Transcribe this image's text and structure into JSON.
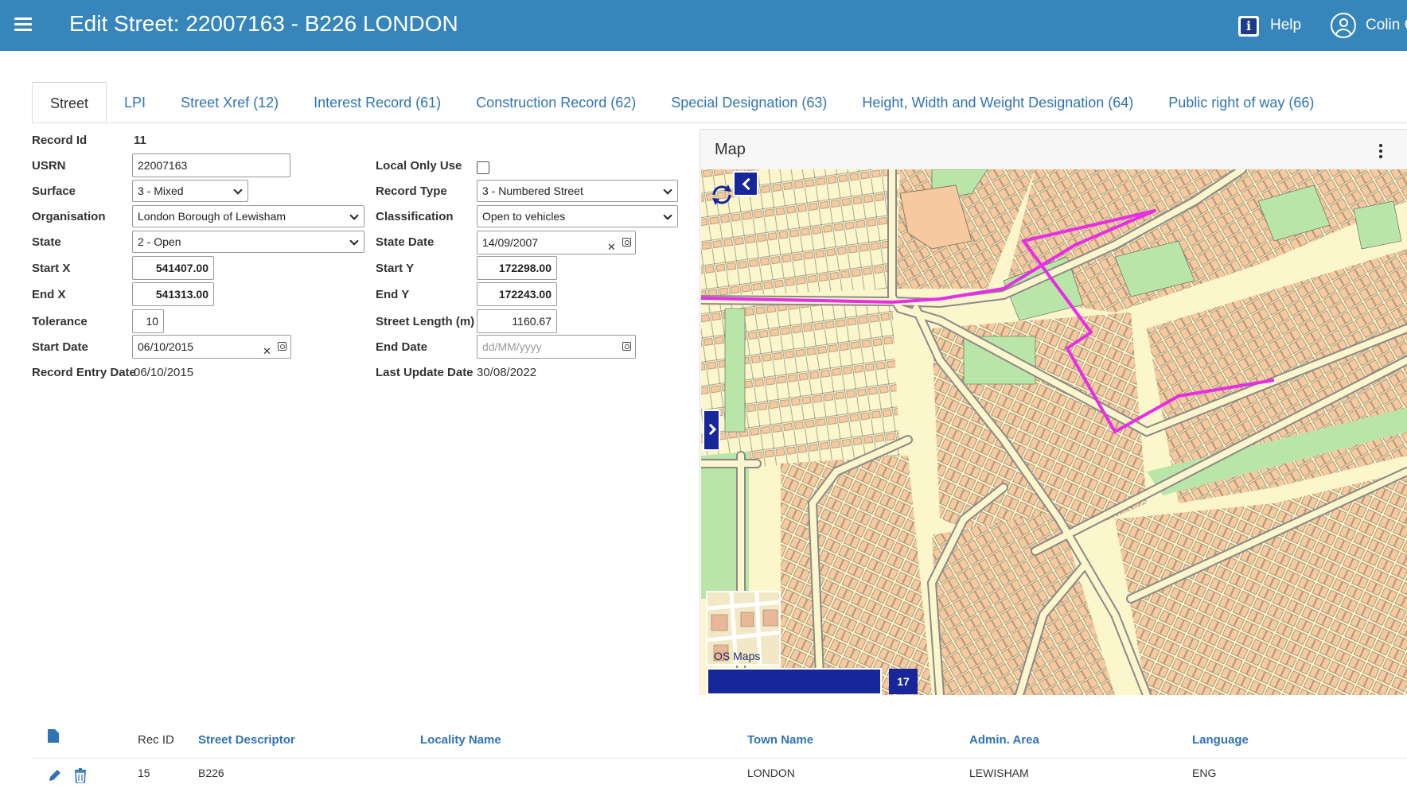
{
  "header": {
    "title": "Edit Street: 22007163 - B226 LONDON",
    "help_label": "Help",
    "user_name": "Colin C"
  },
  "tabs": [
    {
      "label": "Street",
      "active": true
    },
    {
      "label": "LPI"
    },
    {
      "label": "Street Xref (12)"
    },
    {
      "label": "Interest Record (61)"
    },
    {
      "label": "Construction Record (62)"
    },
    {
      "label": "Special Designation (63)"
    },
    {
      "label": "Height, Width and Weight Designation (64)"
    },
    {
      "label": "Public right of way (66)"
    }
  ],
  "form": {
    "record_id": {
      "label": "Record Id",
      "value": "11"
    },
    "usrn": {
      "label": "USRN",
      "value": "22007163"
    },
    "surface": {
      "label": "Surface",
      "value": "3 - Mixed"
    },
    "organisation": {
      "label": "Organisation",
      "value": "London Borough of Lewisham"
    },
    "state": {
      "label": "State",
      "value": "2 - Open"
    },
    "start_x": {
      "label": "Start X",
      "value": "541407.00"
    },
    "end_x": {
      "label": "End X",
      "value": "541313.00"
    },
    "tolerance": {
      "label": "Tolerance",
      "value": "10"
    },
    "start_date": {
      "label": "Start Date",
      "value": "06/10/2015"
    },
    "record_entry_date": {
      "label": "Record Entry Date",
      "value": "06/10/2015"
    },
    "local_only_use": {
      "label": "Local Only Use",
      "checked": false
    },
    "record_type": {
      "label": "Record Type",
      "value": "3 - Numbered Street"
    },
    "classification": {
      "label": "Classification",
      "value": "Open to vehicles"
    },
    "state_date": {
      "label": "State Date",
      "value": "14/09/2007"
    },
    "start_y": {
      "label": "Start Y",
      "value": "172298.00"
    },
    "end_y": {
      "label": "End Y",
      "value": "172243.00"
    },
    "street_length": {
      "label": "Street Length (m)",
      "value": "1160.67"
    },
    "end_date": {
      "label": "End Date",
      "placeholder": "dd/MM/yyyy"
    },
    "last_update_date": {
      "label": "Last Update Date",
      "value": "30/08/2022"
    }
  },
  "map": {
    "title": "Map",
    "basemap_label": "OS Maps",
    "zoom_level": "17",
    "colors": {
      "street_highlight": "#e62ee6",
      "buildings": "#f6c9a0",
      "greenspace": "#b9e6a8",
      "roads": "#8a8a8a",
      "background": "#fbf6cc"
    }
  },
  "table": {
    "columns": [
      "Rec ID",
      "Street Descriptor",
      "Locality Name",
      "Town Name",
      "Admin. Area",
      "Language"
    ],
    "rows": [
      {
        "rec_id": "15",
        "street_descriptor": "B226",
        "locality_name": "",
        "town_name": "LONDON",
        "admin_area": "LEWISHAM",
        "language": "ENG"
      }
    ]
  },
  "colors": {
    "header_bg": "#3786bb",
    "link": "#2f74b5",
    "map_control": "#17269b"
  }
}
